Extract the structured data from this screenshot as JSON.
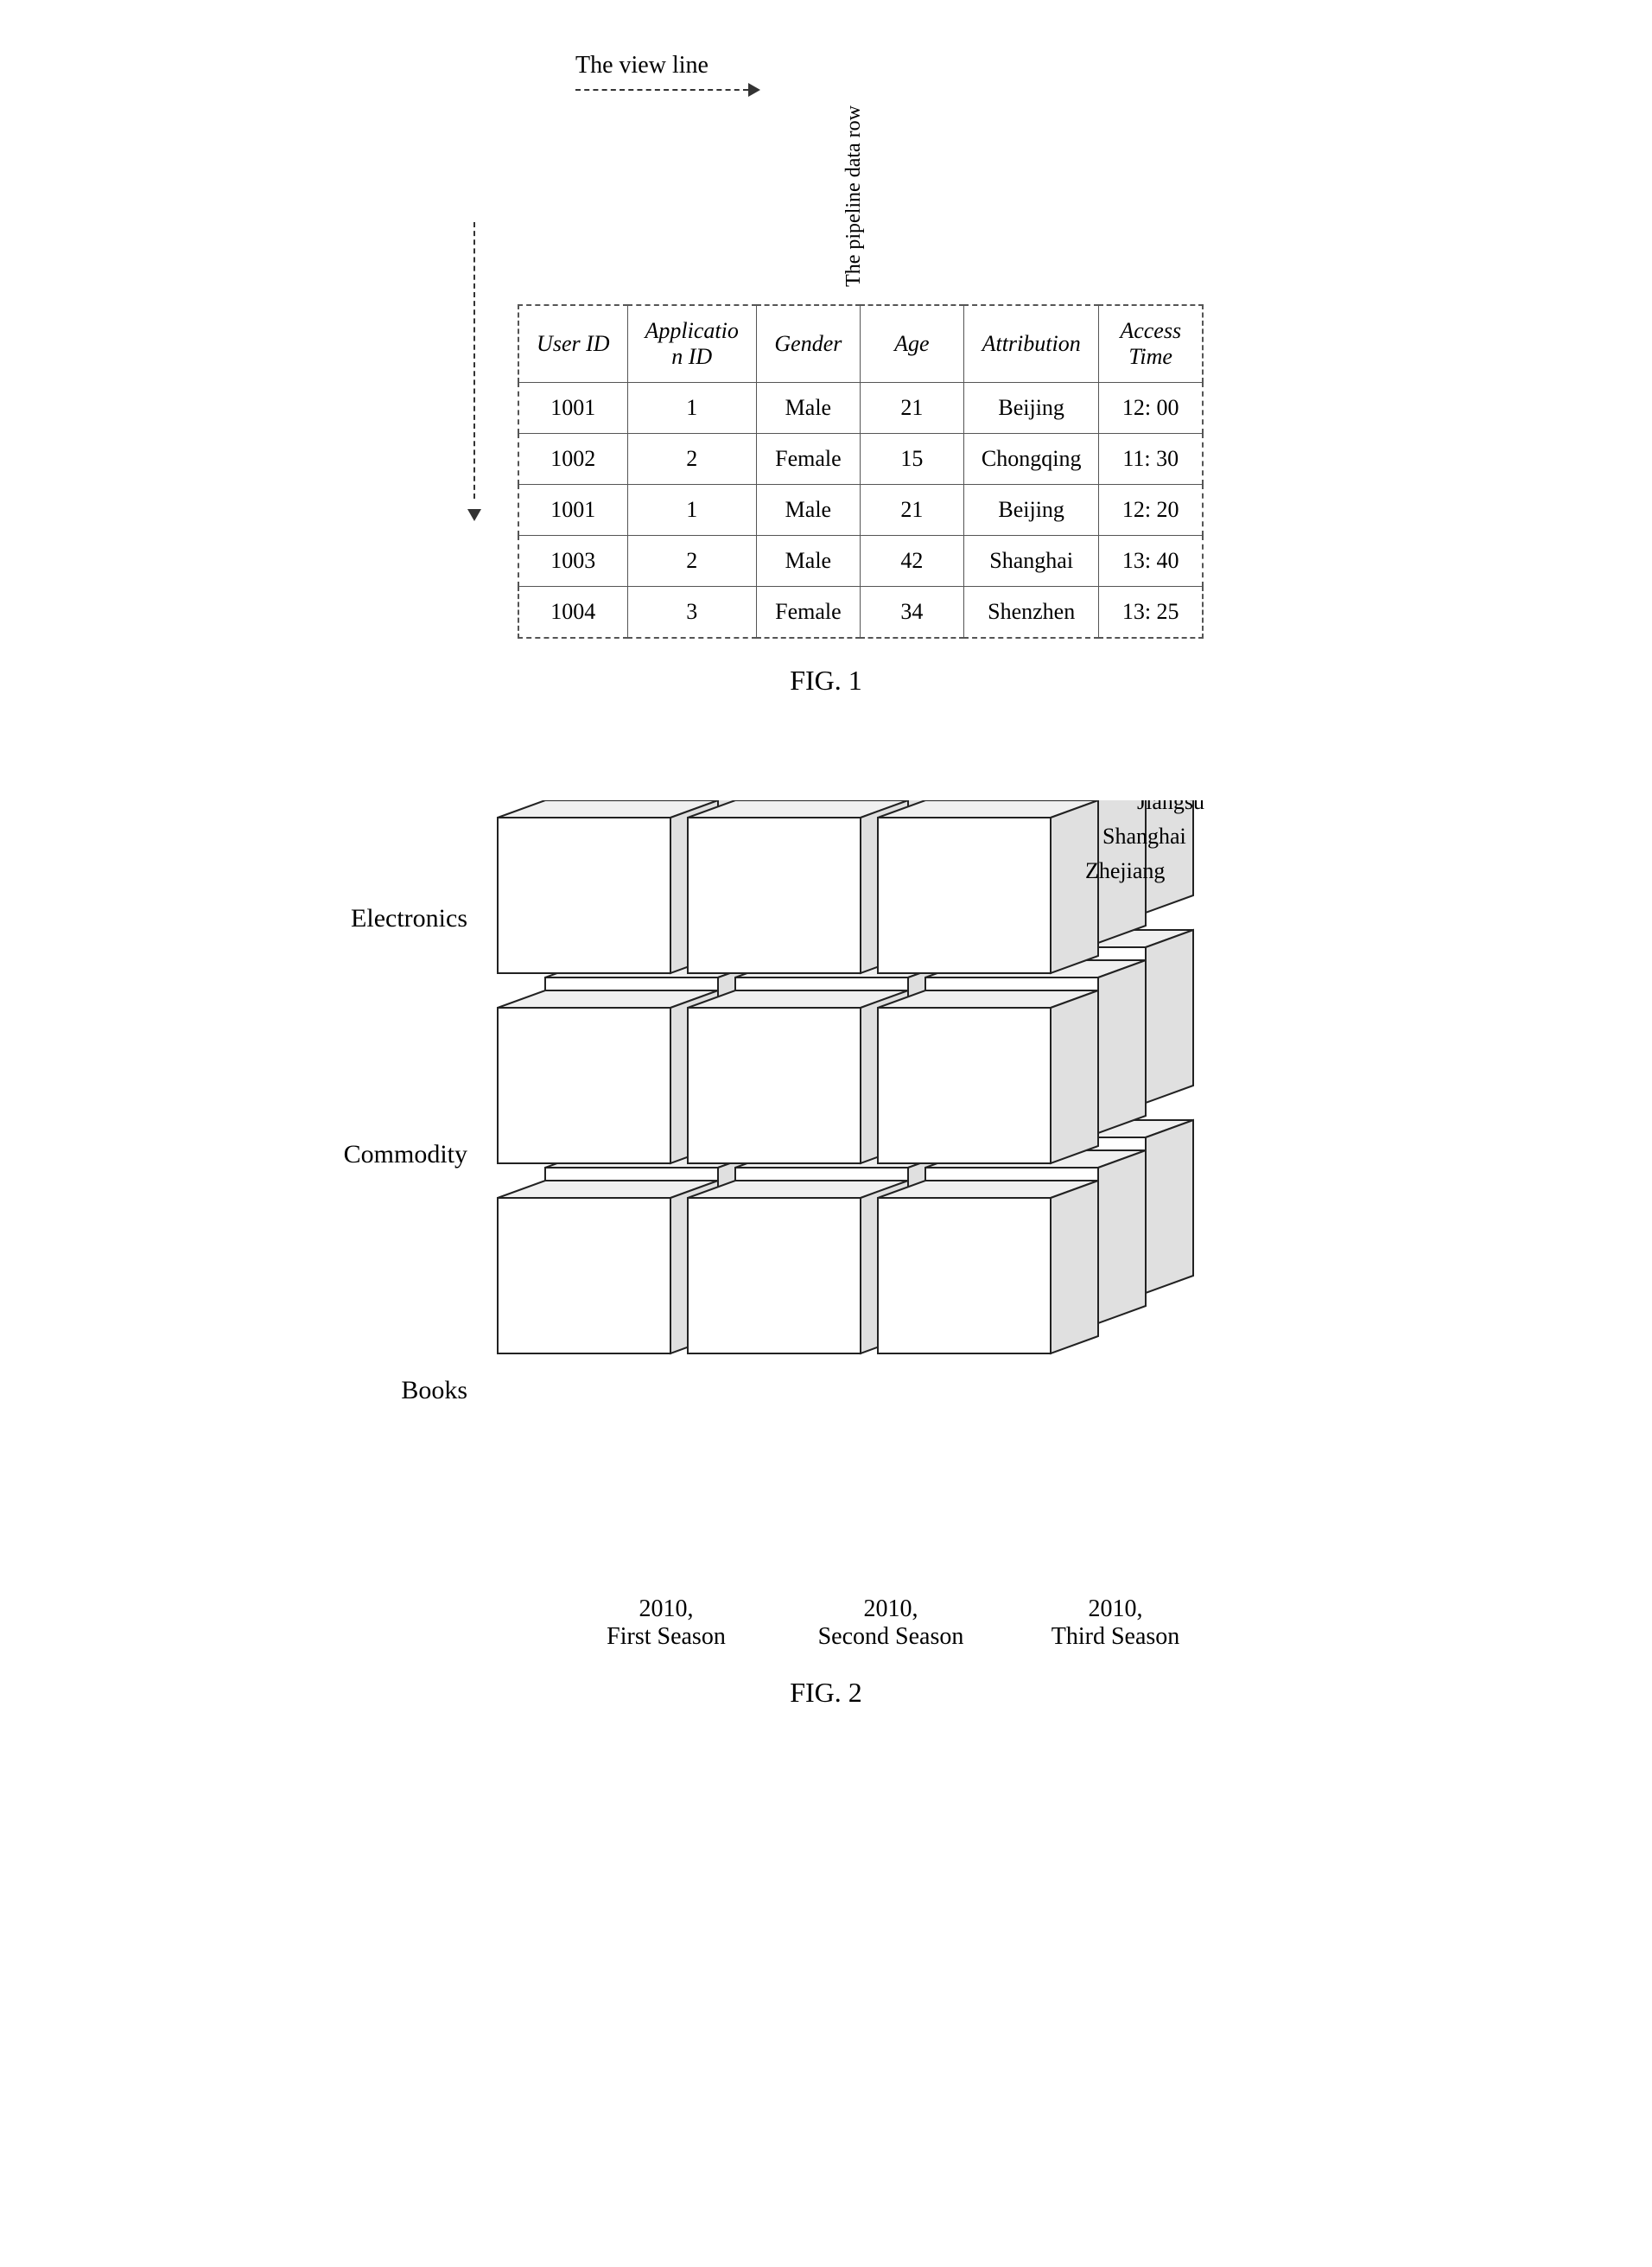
{
  "fig1": {
    "caption": "FIG. 1",
    "viewline_label": "The view line",
    "pipeline_label": "The pipeline data row",
    "table": {
      "headers": [
        "User ID",
        "Applicatio n ID",
        "Gender",
        "Age",
        "Attribution",
        "Access Time"
      ],
      "rows": [
        [
          "1001",
          "1",
          "Male",
          "21",
          "Beijing",
          "12: 00"
        ],
        [
          "1002",
          "2",
          "Female",
          "15",
          "Chongqing",
          "11: 30"
        ],
        [
          "1001",
          "1",
          "Male",
          "21",
          "Beijing",
          "12: 20"
        ],
        [
          "1003",
          "2",
          "Male",
          "42",
          "Shanghai",
          "13: 40"
        ],
        [
          "1004",
          "3",
          "Female",
          "34",
          "Shenzhen",
          "13: 25"
        ]
      ]
    }
  },
  "fig2": {
    "caption": "FIG. 2",
    "left_labels": [
      "Electronics",
      "Commodity",
      "Books"
    ],
    "right_labels": [
      "Jiangsu",
      "Shanghai",
      "Zhejiang"
    ],
    "bottom_labels": [
      "2010,\nFirst Season",
      "2010,\nSecond Season",
      "2010,\nThird Season"
    ]
  }
}
